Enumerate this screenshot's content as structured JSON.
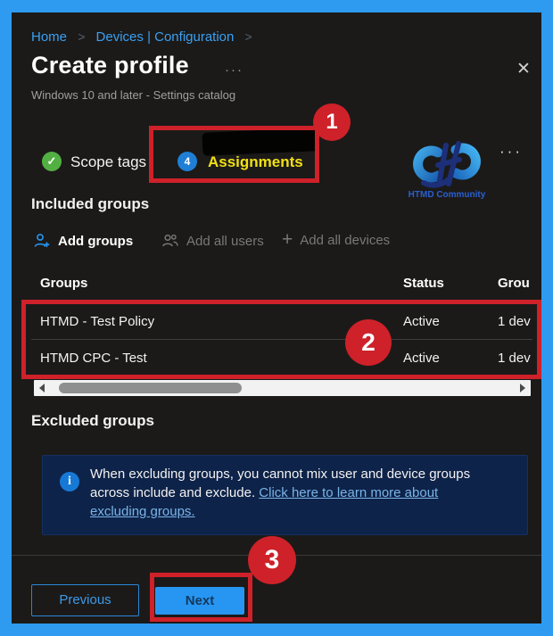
{
  "window": {
    "title": "Create profile",
    "subtitle": "Windows 10 and later - Settings catalog"
  },
  "breadcrumb": {
    "separator": ">",
    "items": [
      "Home",
      "Devices | Configuration"
    ]
  },
  "icons": {
    "close": "✕",
    "check": "✓",
    "more": "···",
    "plus": "+",
    "info": "i"
  },
  "tabs": {
    "scope_tags": {
      "label": "Scope tags"
    },
    "assignments": {
      "label": "Assignments",
      "badge": "4"
    }
  },
  "brand": {
    "name": "HTMD Community"
  },
  "included_section": {
    "heading": "Included groups",
    "toolbar": {
      "add_groups": "Add groups",
      "add_all_users": "Add all users",
      "add_all_devices": "Add all devices"
    }
  },
  "table": {
    "headers": {
      "groups": "Groups",
      "status": "Status",
      "group_members": "Grou"
    },
    "rows": [
      {
        "name": "HTMD - Test Policy",
        "status": "Active",
        "members": "1 dev"
      },
      {
        "name": "HTMD CPC - Test",
        "status": "Active",
        "members": "1 dev"
      }
    ]
  },
  "excluded_section": {
    "heading": "Excluded groups",
    "info_text": "When excluding groups, you cannot mix user and device groups across include and exclude. ",
    "info_link": "Click here to learn more about excluding groups."
  },
  "footer": {
    "previous": "Previous",
    "next": "Next"
  },
  "annotations": {
    "step_1": "1",
    "step_2": "2",
    "step_3": "3"
  },
  "colors": {
    "frame_blue": "#2e9bf0",
    "panel_bg": "#1b1a19",
    "annotation_red": "#ce2129",
    "accent_blue": "#2796f2",
    "success_green": "#52b043",
    "badge_blue": "#1f7fd6",
    "highlight_yellow": "#f2e013",
    "info_box_bg": "#0e2349",
    "link_blue": "#7ab4e8"
  }
}
